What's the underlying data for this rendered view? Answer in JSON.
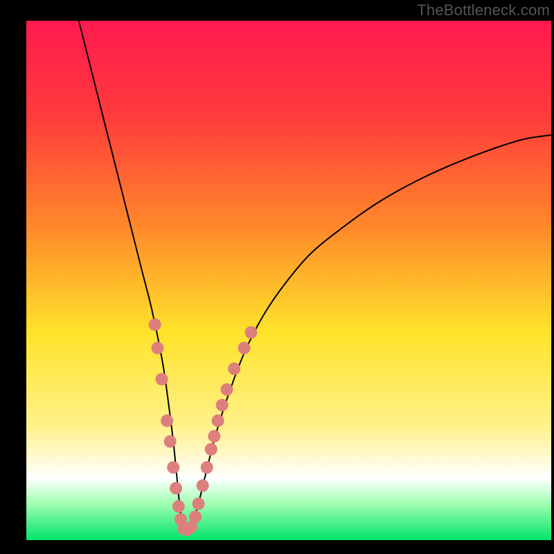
{
  "watermark": "TheBottleneck.com",
  "chart_data": {
    "type": "line",
    "title": "",
    "xlabel": "",
    "ylabel": "",
    "xlim": [
      0,
      100
    ],
    "ylim": [
      0,
      100
    ],
    "grid": false,
    "legend": false,
    "axes_visible": false,
    "background_gradient": {
      "type": "vertical",
      "stops": [
        {
          "pos": 0.0,
          "color": "#ff1a4f"
        },
        {
          "pos": 0.18,
          "color": "#ff3a3c"
        },
        {
          "pos": 0.4,
          "color": "#ff8a2a"
        },
        {
          "pos": 0.6,
          "color": "#ffe32a"
        },
        {
          "pos": 0.78,
          "color": "#fff18a"
        },
        {
          "pos": 0.88,
          "color": "#ffffff"
        },
        {
          "pos": 0.93,
          "color": "#9fffb0"
        },
        {
          "pos": 1.0,
          "color": "#00e36a"
        }
      ]
    },
    "series": [
      {
        "name": "bottleneck-curve",
        "color": "#000000",
        "width": 2.0,
        "x": [
          10,
          12,
          14,
          16,
          18,
          20,
          22,
          24,
          26,
          27,
          28,
          28.7,
          29.3,
          30,
          31,
          32.5,
          34,
          36,
          38.5,
          41.5,
          45,
          49,
          54,
          60,
          67,
          75,
          84,
          94,
          100
        ],
        "y": [
          100,
          92,
          84,
          76,
          68,
          60,
          52,
          44,
          34,
          27,
          19,
          12,
          6,
          2,
          2,
          6,
          12,
          20,
          28,
          36,
          43,
          49,
          55,
          60,
          65,
          69.5,
          73.5,
          77,
          78
        ]
      }
    ],
    "markers": [
      {
        "name": "curve-dots",
        "color": "#dd7f7c",
        "radius": 9,
        "points": [
          {
            "x": 24.5,
            "y": 41.5
          },
          {
            "x": 25.0,
            "y": 37.0
          },
          {
            "x": 25.8,
            "y": 31.0
          },
          {
            "x": 26.8,
            "y": 23.0
          },
          {
            "x": 27.4,
            "y": 19.0
          },
          {
            "x": 28.0,
            "y": 14.0
          },
          {
            "x": 28.5,
            "y": 10.0
          },
          {
            "x": 29.0,
            "y": 6.5
          },
          {
            "x": 29.4,
            "y": 4.0
          },
          {
            "x": 30.0,
            "y": 2.2
          },
          {
            "x": 30.6,
            "y": 2.0
          },
          {
            "x": 31.4,
            "y": 2.5
          },
          {
            "x": 32.2,
            "y": 4.5
          },
          {
            "x": 32.8,
            "y": 7.0
          },
          {
            "x": 33.6,
            "y": 10.5
          },
          {
            "x": 34.4,
            "y": 14.0
          },
          {
            "x": 35.2,
            "y": 17.5
          },
          {
            "x": 35.8,
            "y": 20.0
          },
          {
            "x": 36.5,
            "y": 23.0
          },
          {
            "x": 37.3,
            "y": 26.0
          },
          {
            "x": 38.2,
            "y": 29.0
          },
          {
            "x": 39.6,
            "y": 33.0
          },
          {
            "x": 41.5,
            "y": 37.0
          },
          {
            "x": 42.8,
            "y": 40.0
          }
        ]
      }
    ]
  },
  "colors": {
    "frame": "#000000",
    "curve": "#000000",
    "marker": "#dd7f7c"
  }
}
